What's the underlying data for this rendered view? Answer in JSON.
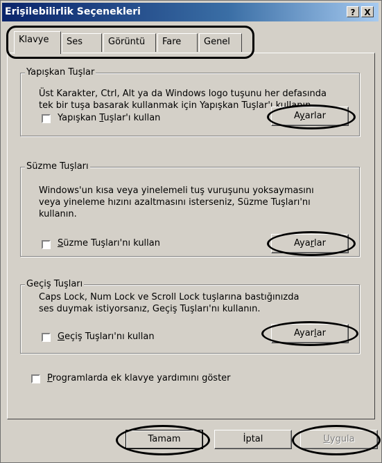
{
  "window": {
    "title": "Erişilebilirlik Seçenekleri",
    "help_label": "?",
    "close_label": "X"
  },
  "tabs": [
    {
      "label": "Klavye",
      "active": true
    },
    {
      "label": "Ses",
      "active": false
    },
    {
      "label": "Görüntü",
      "active": false
    },
    {
      "label": "Fare",
      "active": false
    },
    {
      "label": "Genel",
      "active": false
    }
  ],
  "sticky_keys": {
    "title": "Yapışkan Tuşlar",
    "description_line1": "Üst Karakter, Ctrl, Alt ya da Windows logo tuşunu her defasında",
    "description_line2": "tek bir tuşa basarak kullanmak için Yapışkan Tuşlar'ı kullanın.",
    "checkbox_label_pre": "Yapışkan ",
    "checkbox_label_ul": "T",
    "checkbox_label_post": "uşlar'ı kullan",
    "checked": false,
    "settings_pre": "A",
    "settings_ul": "y",
    "settings_post": "arlar"
  },
  "filter_keys": {
    "title": "Süzme Tuşları",
    "description_line1": "Windows'un kısa veya yinelemeli tuş vuruşunu yoksaymasını",
    "description_line2": "veya yineleme hızını azaltmasını isterseniz, Süzme Tuşları'nı",
    "description_line3": "kullanın.",
    "checkbox_label_pre": "",
    "checkbox_label_ul": "S",
    "checkbox_label_post": "üzme Tuşları'nı kullan",
    "checked": false,
    "settings_pre": "Aya",
    "settings_ul": "r",
    "settings_post": "lar"
  },
  "toggle_keys": {
    "title": "Geçiş Tuşları",
    "description_line1": "Caps Lock, Num Lock ve Scroll Lock tuşlarına bastığınızda",
    "description_line2": "ses duymak istiyorsanız, Geçiş Tuşları'nı kullanın.",
    "checkbox_label_pre": "",
    "checkbox_label_ul": "G",
    "checkbox_label_post": "eçiş Tuşları'nı kullan",
    "checked": false,
    "settings_pre": "Ayar",
    "settings_ul": "l",
    "settings_post": "ar"
  },
  "extra_help": {
    "label_pre": "",
    "label_ul": "P",
    "label_post": "rogramlarda ek klavye yardımını göster",
    "checked": false
  },
  "footer": {
    "ok_label": "Tamam",
    "cancel_label": "İptal",
    "apply_pre": "",
    "apply_ul": "U",
    "apply_post": "ygula"
  }
}
